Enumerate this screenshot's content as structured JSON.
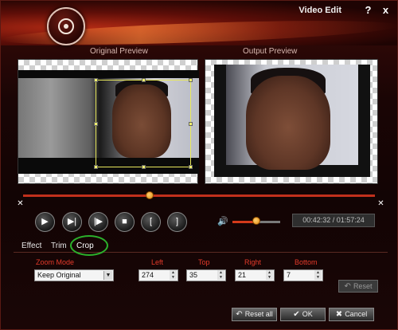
{
  "window": {
    "title": "Video Edit",
    "help_label": "?",
    "close_label": "x"
  },
  "preview": {
    "original_label": "Original Preview",
    "output_label": "Output Preview"
  },
  "playback": {
    "time": "00:42:32 / 01:57:24",
    "seek_position": 0.36,
    "volume_level": 0.5,
    "icons": [
      "play-icon",
      "play-step-icon",
      "frame-step-icon",
      "stop-icon",
      "mark-in-icon",
      "mark-out-icon",
      "volume-icon"
    ],
    "glyphs": {
      "play": "▶",
      "step": "▶|",
      "frame": "|▶",
      "stop": "■",
      "mark_in": "[",
      "mark_out": "]",
      "volume": "🔊",
      "seek_start": "✕",
      "seek_end": "✕"
    }
  },
  "tabs": [
    {
      "label": "Effect"
    },
    {
      "label": "Trim"
    },
    {
      "label": "Crop",
      "active": true
    }
  ],
  "crop": {
    "zoom_mode_label": "Zoom Mode",
    "zoom_mode_value": "Keep Original",
    "left_label": "Left",
    "left_value": "274",
    "top_label": "Top",
    "top_value": "35",
    "right_label": "Right",
    "right_value": "21",
    "bottom_label": "Bottom",
    "bottom_value": "7",
    "reset_label": "Reset"
  },
  "footer": {
    "reset_all_label": "Reset all",
    "ok_label": "OK",
    "cancel_label": "Cancel"
  },
  "colors": {
    "accent": "#c0301c",
    "label_red": "#e43a2a",
    "crop_handle": "#f0f070",
    "highlight_ring": "#2bb02b"
  }
}
